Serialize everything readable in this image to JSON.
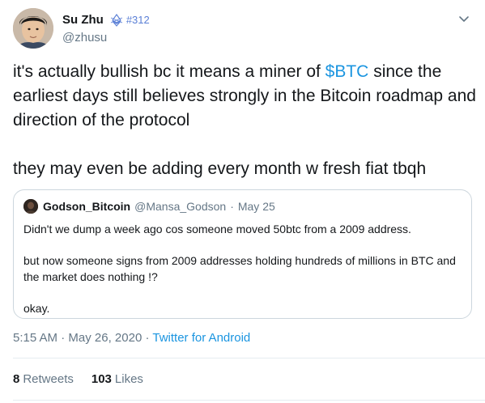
{
  "author": {
    "name": "Su Zhu",
    "badge": "#312",
    "handle": "@zhusu"
  },
  "tweet": {
    "text_before": "it's actually bullish bc it means a miner of ",
    "cashtag": "$BTC",
    "text_after": " since the earliest days still believes strongly in the Bitcoin roadmap and direction of the protocol",
    "paragraph_2": "they may even be adding every month w fresh fiat tbqh"
  },
  "quoted_tweet": {
    "name": "Godson_Bitcoin",
    "handle": "@Mansa_Godson",
    "separator": "·",
    "date": "May 25",
    "paragraphs": [
      "Didn't we dump a week ago cos someone moved 50btc from a 2009 address.",
      "but now someone signs from 2009 addresses holding hundreds of millions in BTC and the market does nothing !?",
      "okay."
    ]
  },
  "meta": {
    "time": "5:15 AM",
    "sep1": "·",
    "date": "May 26, 2020",
    "sep2": "·",
    "source": "Twitter for Android"
  },
  "stats": {
    "retweets_count": "8",
    "retweets_label": "Retweets",
    "likes_count": "103",
    "likes_label": "Likes"
  },
  "colors": {
    "link": "#1b95e0",
    "secondary_text": "#657786",
    "border": "#ccd6dd",
    "badge": "#5a7fd6"
  },
  "icons": {
    "badge": "ethereum-badge-icon",
    "menu": "chevron-down-icon"
  }
}
